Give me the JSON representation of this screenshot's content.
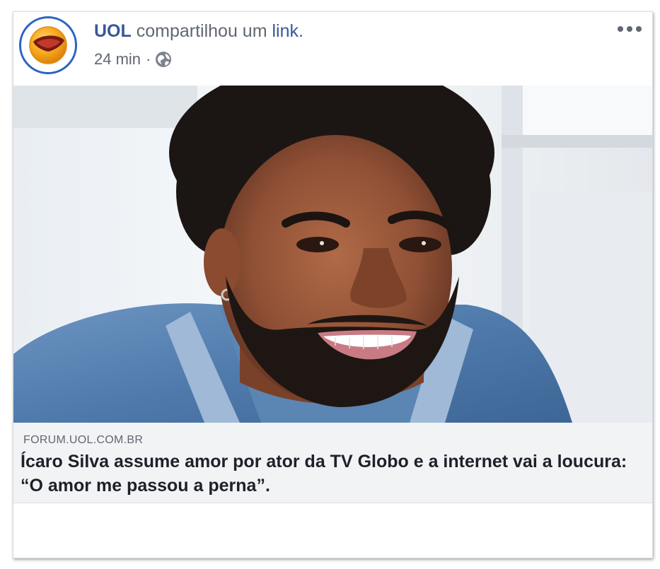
{
  "post": {
    "author": "UOL",
    "action_text": "compartilhou um",
    "link_text": "link.",
    "timestamp": "24 min",
    "separator": "·",
    "privacy_icon": "globe-icon",
    "more_icon": "more-options-icon"
  },
  "link_preview": {
    "domain": "FORUM.UOL.COM.BR",
    "headline": "Ícaro Silva assume amor por ator da TV Globo e a internet vai a loucura: “O amor me passou a perna”."
  },
  "colors": {
    "author": "#385898",
    "avatar_ring": "#2d62c5",
    "logo_orange": "#f5a71c",
    "link_box_bg": "#f2f3f5",
    "shirt_blue": "#5b86b4"
  }
}
